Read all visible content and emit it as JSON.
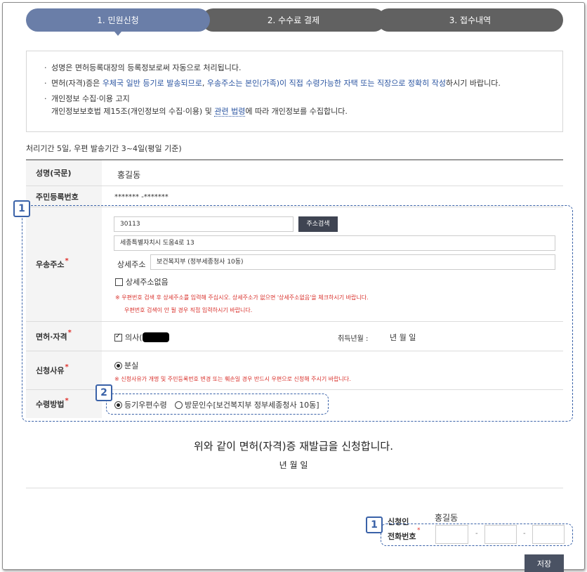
{
  "steps": [
    {
      "label": "1. 민원신청",
      "active": true
    },
    {
      "label": "2. 수수료 결제",
      "active": false
    },
    {
      "label": "3. 접수내역",
      "active": false
    }
  ],
  "notice": {
    "line1": "성명은 면허등록대장의 등록정보로써 자동으로 처리됩니다.",
    "line2_a": "면허(자격)증은 ",
    "line2_b": "우체국 일반 등기로 발송되므로",
    "line2_c": ", ",
    "line2_d": "우송주소는 본인(가족)이 직접 수령가능한 자택 또는 직장으로 정확히 작성",
    "line2_e": "하시기 바랍니다.",
    "line3": "개인정보 수집·이용 고지",
    "line4_a": "개인정보보호법 제15조(개인정보의 수집·이용) 및 ",
    "line4_link": "관련 법령",
    "line4_b": "에 따라 개인정보를 수집합니다."
  },
  "processing_period": "처리기간 5일, 우편 발송기간 3~4일(평일 기준)",
  "form": {
    "name_label": "성명(국문)",
    "name_value": "홍길동",
    "rrn_label": "주민등록번호",
    "rrn_value": "******* -*******",
    "address_label": "우송주소",
    "postcode": "30113",
    "address_search_button": "주소검색",
    "address_main": "세종특별자치시 도움4로 13",
    "address_detail_label": "상세주소",
    "address_detail": "보건복지부 (정부세종청사 10동)",
    "no_detail_checkbox": "상세주소없음",
    "address_warn1": "※  우편번호 검색 후 상세주소를 입력해 주십시오. 상세주소가 없으면 '상세주소없음'을 체크하시기 바랍니다.",
    "address_warn2": "우편번호 검색이 안 될 경우 직접 입력하시기 바랍니다.",
    "license_label": "면허·자격",
    "license_value": "의사(",
    "acquired_label": "취득년월 :",
    "acquired_value": "년  월  일",
    "reason_label": "신청사유",
    "reason_option": "분실",
    "reason_warn": "※  신청사유가 개명 및 주민등록번호 변경 또는 훼손일 경우 반드시 우편으로 신청해 주시기 바랍니다.",
    "receive_label": "수령방법",
    "receive_opt1": "등기우편수령",
    "receive_opt2": "방문인수[보건복지부 정부세종청사 10동]"
  },
  "callouts": {
    "badge1": "1",
    "badge2": "2",
    "badge3": "1"
  },
  "declaration": {
    "text": "위와 같이 면허(자격)증 재발급을 신청합니다.",
    "date": "년   월   일"
  },
  "applicant": {
    "label": "신청인",
    "name": "홍길동",
    "phone_label": "전화번호",
    "phone_sep": "-"
  },
  "save_button": "저장",
  "colors": {
    "active_step": "#6a7ea8",
    "inactive_step": "#616161",
    "callout": "#3a62a8",
    "warning": "#d9302b"
  }
}
